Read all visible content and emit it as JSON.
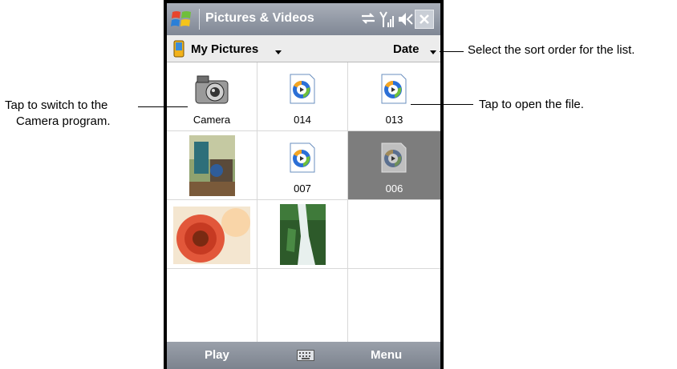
{
  "app": {
    "title": "Pictures & Videos",
    "icons": [
      "windows-start-icon",
      "sync-icon",
      "signal-icon",
      "volume-icon",
      "close-icon"
    ]
  },
  "toolbar": {
    "folder_label": "My Pictures",
    "sort_label": "Date"
  },
  "grid": {
    "items": [
      {
        "label": "Camera",
        "type": "camera-icon"
      },
      {
        "label": "014",
        "type": "media-file-icon"
      },
      {
        "label": "013",
        "type": "media-file-icon"
      },
      {
        "label": "",
        "type": "photo-thumbnail"
      },
      {
        "label": "007",
        "type": "media-file-icon"
      },
      {
        "label": "006",
        "type": "media-file-icon",
        "selected": true
      },
      {
        "label": "",
        "type": "photo-thumbnail-flower"
      },
      {
        "label": "",
        "type": "photo-thumbnail-waterfall"
      }
    ]
  },
  "softkeys": {
    "left": "Play",
    "right": "Menu",
    "center_icon": "keyboard-icon"
  },
  "callouts": {
    "camera_line1": "Tap to switch to the",
    "camera_line2": "Camera program.",
    "sort": "Select the sort order for the list.",
    "open": "Tap to open the file."
  },
  "colors": {
    "selected_cell": "#7d7d7d",
    "titlebar": "#9098a4",
    "media_blue": "#2b6fd6"
  }
}
